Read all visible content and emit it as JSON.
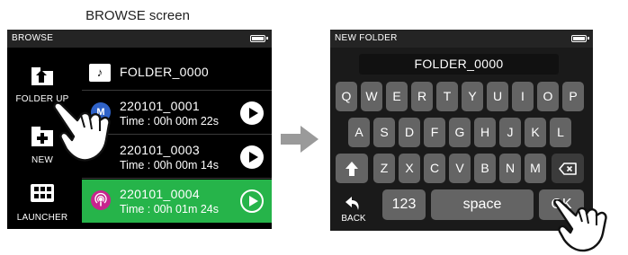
{
  "caption": "BROWSE screen",
  "browse": {
    "title": "BROWSE",
    "side_buttons": [
      {
        "label": "FOLDER UP"
      },
      {
        "label": "NEW"
      },
      {
        "label": "LAUNCHER"
      }
    ],
    "folder": {
      "name": "FOLDER_0000"
    },
    "files": [
      {
        "name": "220101_0001",
        "time": "Time : 00h 00m 22s",
        "badge": "M",
        "badge_type": "mono",
        "selected": false
      },
      {
        "name": "220101_0003",
        "time": "Time : 00h 00m 14s",
        "badge": "",
        "badge_type": "none",
        "selected": false
      },
      {
        "name": "220101_0004",
        "time": "Time : 00h 01m 24s",
        "badge": "",
        "badge_type": "podcast",
        "selected": true
      }
    ]
  },
  "new_folder": {
    "title": "NEW FOLDER",
    "field_value": "FOLDER_0000",
    "row1": [
      "Q",
      "W",
      "E",
      "R",
      "T",
      "Y",
      "U",
      "I",
      "O",
      "P"
    ],
    "row2": [
      "A",
      "S",
      "D",
      "F",
      "G",
      "H",
      "J",
      "K",
      "L"
    ],
    "row3": [
      "Z",
      "X",
      "C",
      "V",
      "B",
      "N",
      "M"
    ],
    "numbers_label": "123",
    "space_label": "space",
    "ok_label": "OK",
    "back_label": "BACK"
  },
  "colors": {
    "selected_row": "#26b44a",
    "mono_badge": "#2f62c8",
    "podcast_badge": "#c7248e",
    "key": "#646464",
    "arrow": "#9a9a9a"
  },
  "icons": [
    "folder-up-icon",
    "new-folder-icon",
    "launcher-icon",
    "music-folder-icon",
    "play-icon",
    "shift-icon",
    "backspace-icon",
    "back-icon",
    "pointing-hand-icon",
    "right-arrow-icon",
    "battery-icon"
  ]
}
